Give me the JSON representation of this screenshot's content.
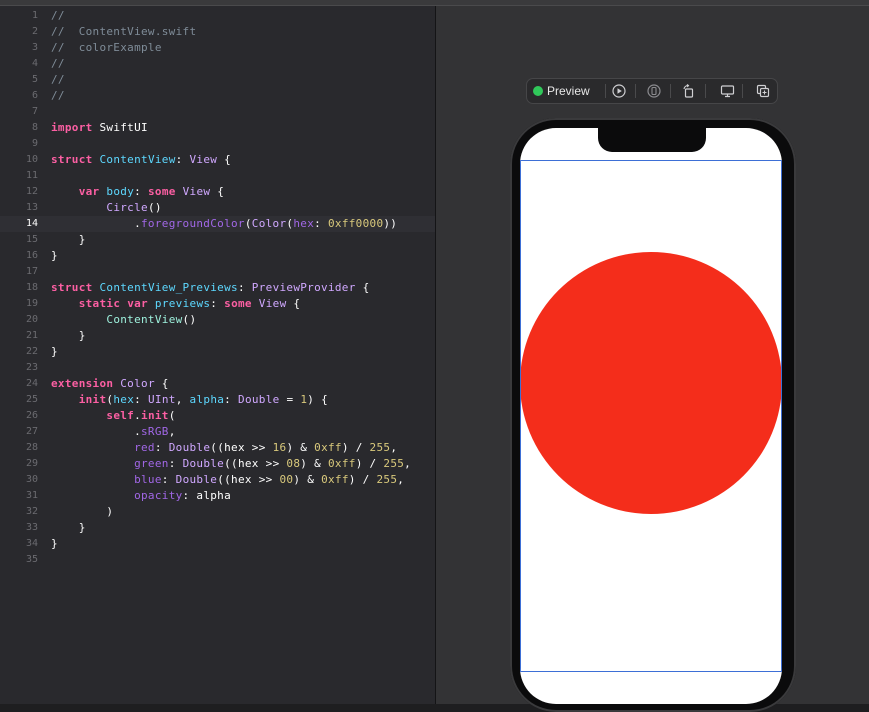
{
  "editor": {
    "active_line": 14,
    "lines": [
      {
        "n": "1",
        "tokens": [
          [
            "com",
            "//"
          ]
        ]
      },
      {
        "n": "2",
        "tokens": [
          [
            "com",
            "//  ContentView.swift"
          ]
        ]
      },
      {
        "n": "3",
        "tokens": [
          [
            "com",
            "//  colorExample"
          ]
        ]
      },
      {
        "n": "4",
        "tokens": [
          [
            "com",
            "//"
          ]
        ]
      },
      {
        "n": "5",
        "tokens": [
          [
            "com",
            "//"
          ]
        ]
      },
      {
        "n": "6",
        "tokens": [
          [
            "com",
            "//"
          ]
        ]
      },
      {
        "n": "7",
        "tokens": []
      },
      {
        "n": "8",
        "tokens": [
          [
            "kw",
            "import"
          ],
          [
            "plain",
            " SwiftUI"
          ]
        ]
      },
      {
        "n": "9",
        "tokens": []
      },
      {
        "n": "10",
        "tokens": [
          [
            "kw",
            "struct"
          ],
          [
            "plain",
            " "
          ],
          [
            "decl",
            "ContentView"
          ],
          [
            "plain",
            ": "
          ],
          [
            "type",
            "View"
          ],
          [
            "plain",
            " {"
          ]
        ]
      },
      {
        "n": "11",
        "tokens": []
      },
      {
        "n": "12",
        "tokens": [
          [
            "plain",
            "    "
          ],
          [
            "kw",
            "var"
          ],
          [
            "plain",
            " "
          ],
          [
            "decl",
            "body"
          ],
          [
            "plain",
            ": "
          ],
          [
            "kw",
            "some"
          ],
          [
            "plain",
            " "
          ],
          [
            "type",
            "View"
          ],
          [
            "plain",
            " {"
          ]
        ]
      },
      {
        "n": "13",
        "tokens": [
          [
            "plain",
            "        "
          ],
          [
            "type",
            "Circle"
          ],
          [
            "plain",
            "()"
          ]
        ]
      },
      {
        "n": "14",
        "tokens": [
          [
            "plain",
            "            ."
          ],
          [
            "ext",
            "foregroundColor"
          ],
          [
            "plain",
            "("
          ],
          [
            "type",
            "Color"
          ],
          [
            "plain",
            "("
          ],
          [
            "ext",
            "hex"
          ],
          [
            "plain",
            ": "
          ],
          [
            "num",
            "0xff0000"
          ],
          [
            "plain",
            "))"
          ]
        ]
      },
      {
        "n": "15",
        "tokens": [
          [
            "plain",
            "    }"
          ]
        ]
      },
      {
        "n": "16",
        "tokens": [
          [
            "plain",
            "}"
          ]
        ]
      },
      {
        "n": "17",
        "tokens": []
      },
      {
        "n": "18",
        "tokens": [
          [
            "kw",
            "struct"
          ],
          [
            "plain",
            " "
          ],
          [
            "decl",
            "ContentView_Previews"
          ],
          [
            "plain",
            ": "
          ],
          [
            "type",
            "PreviewProvider"
          ],
          [
            "plain",
            " {"
          ]
        ]
      },
      {
        "n": "19",
        "tokens": [
          [
            "plain",
            "    "
          ],
          [
            "kw",
            "static"
          ],
          [
            "plain",
            " "
          ],
          [
            "kw",
            "var"
          ],
          [
            "plain",
            " "
          ],
          [
            "decl",
            "previews"
          ],
          [
            "plain",
            ": "
          ],
          [
            "kw",
            "some"
          ],
          [
            "plain",
            " "
          ],
          [
            "type",
            "View"
          ],
          [
            "plain",
            " {"
          ]
        ]
      },
      {
        "n": "20",
        "tokens": [
          [
            "plain",
            "        "
          ],
          [
            "projt",
            "ContentView"
          ],
          [
            "plain",
            "()"
          ]
        ]
      },
      {
        "n": "21",
        "tokens": [
          [
            "plain",
            "    }"
          ]
        ]
      },
      {
        "n": "22",
        "tokens": [
          [
            "plain",
            "}"
          ]
        ]
      },
      {
        "n": "23",
        "tokens": []
      },
      {
        "n": "24",
        "tokens": [
          [
            "kw",
            "extension"
          ],
          [
            "plain",
            " "
          ],
          [
            "type",
            "Color"
          ],
          [
            "plain",
            " {"
          ]
        ]
      },
      {
        "n": "25",
        "tokens": [
          [
            "plain",
            "    "
          ],
          [
            "kw",
            "init"
          ],
          [
            "plain",
            "("
          ],
          [
            "decl",
            "hex"
          ],
          [
            "plain",
            ": "
          ],
          [
            "type",
            "UInt"
          ],
          [
            "plain",
            ", "
          ],
          [
            "decl",
            "alpha"
          ],
          [
            "plain",
            ": "
          ],
          [
            "type",
            "Double"
          ],
          [
            "plain",
            " = "
          ],
          [
            "num",
            "1"
          ],
          [
            "plain",
            ") {"
          ]
        ]
      },
      {
        "n": "26",
        "tokens": [
          [
            "plain",
            "        "
          ],
          [
            "kw",
            "self"
          ],
          [
            "plain",
            "."
          ],
          [
            "kw",
            "init"
          ],
          [
            "plain",
            "("
          ]
        ]
      },
      {
        "n": "27",
        "tokens": [
          [
            "plain",
            "            ."
          ],
          [
            "ext",
            "sRGB"
          ],
          [
            "plain",
            ","
          ]
        ]
      },
      {
        "n": "28",
        "tokens": [
          [
            "plain",
            "            "
          ],
          [
            "ext",
            "red"
          ],
          [
            "plain",
            ": "
          ],
          [
            "type",
            "Double"
          ],
          [
            "plain",
            "((hex >> "
          ],
          [
            "num",
            "16"
          ],
          [
            "plain",
            ") & "
          ],
          [
            "num",
            "0xff"
          ],
          [
            "plain",
            ") / "
          ],
          [
            "num",
            "255"
          ],
          [
            "plain",
            ","
          ]
        ]
      },
      {
        "n": "29",
        "tokens": [
          [
            "plain",
            "            "
          ],
          [
            "ext",
            "green"
          ],
          [
            "plain",
            ": "
          ],
          [
            "type",
            "Double"
          ],
          [
            "plain",
            "((hex >> "
          ],
          [
            "num",
            "08"
          ],
          [
            "plain",
            ") & "
          ],
          [
            "num",
            "0xff"
          ],
          [
            "plain",
            ") / "
          ],
          [
            "num",
            "255"
          ],
          [
            "plain",
            ","
          ]
        ]
      },
      {
        "n": "30",
        "tokens": [
          [
            "plain",
            "            "
          ],
          [
            "ext",
            "blue"
          ],
          [
            "plain",
            ": "
          ],
          [
            "type",
            "Double"
          ],
          [
            "plain",
            "((hex >> "
          ],
          [
            "num",
            "00"
          ],
          [
            "plain",
            ") & "
          ],
          [
            "num",
            "0xff"
          ],
          [
            "plain",
            ") / "
          ],
          [
            "num",
            "255"
          ],
          [
            "plain",
            ","
          ]
        ]
      },
      {
        "n": "31",
        "tokens": [
          [
            "plain",
            "            "
          ],
          [
            "ext",
            "opacity"
          ],
          [
            "plain",
            ": alpha"
          ]
        ]
      },
      {
        "n": "32",
        "tokens": [
          [
            "plain",
            "        )"
          ]
        ]
      },
      {
        "n": "33",
        "tokens": [
          [
            "plain",
            "    }"
          ]
        ]
      },
      {
        "n": "34",
        "tokens": [
          [
            "plain",
            "}"
          ]
        ]
      },
      {
        "n": "35",
        "tokens": []
      }
    ]
  },
  "preview": {
    "label": "Preview",
    "status_color": "#30c85a",
    "toolbar_icons": [
      "live-play-icon",
      "selectable-icon",
      "rotate-device-icon",
      "device-settings-icon",
      "duplicate-preview-icon"
    ]
  },
  "device": {
    "circle_color": "#f42d1b",
    "safe_area_color": "#3d6fd6"
  }
}
